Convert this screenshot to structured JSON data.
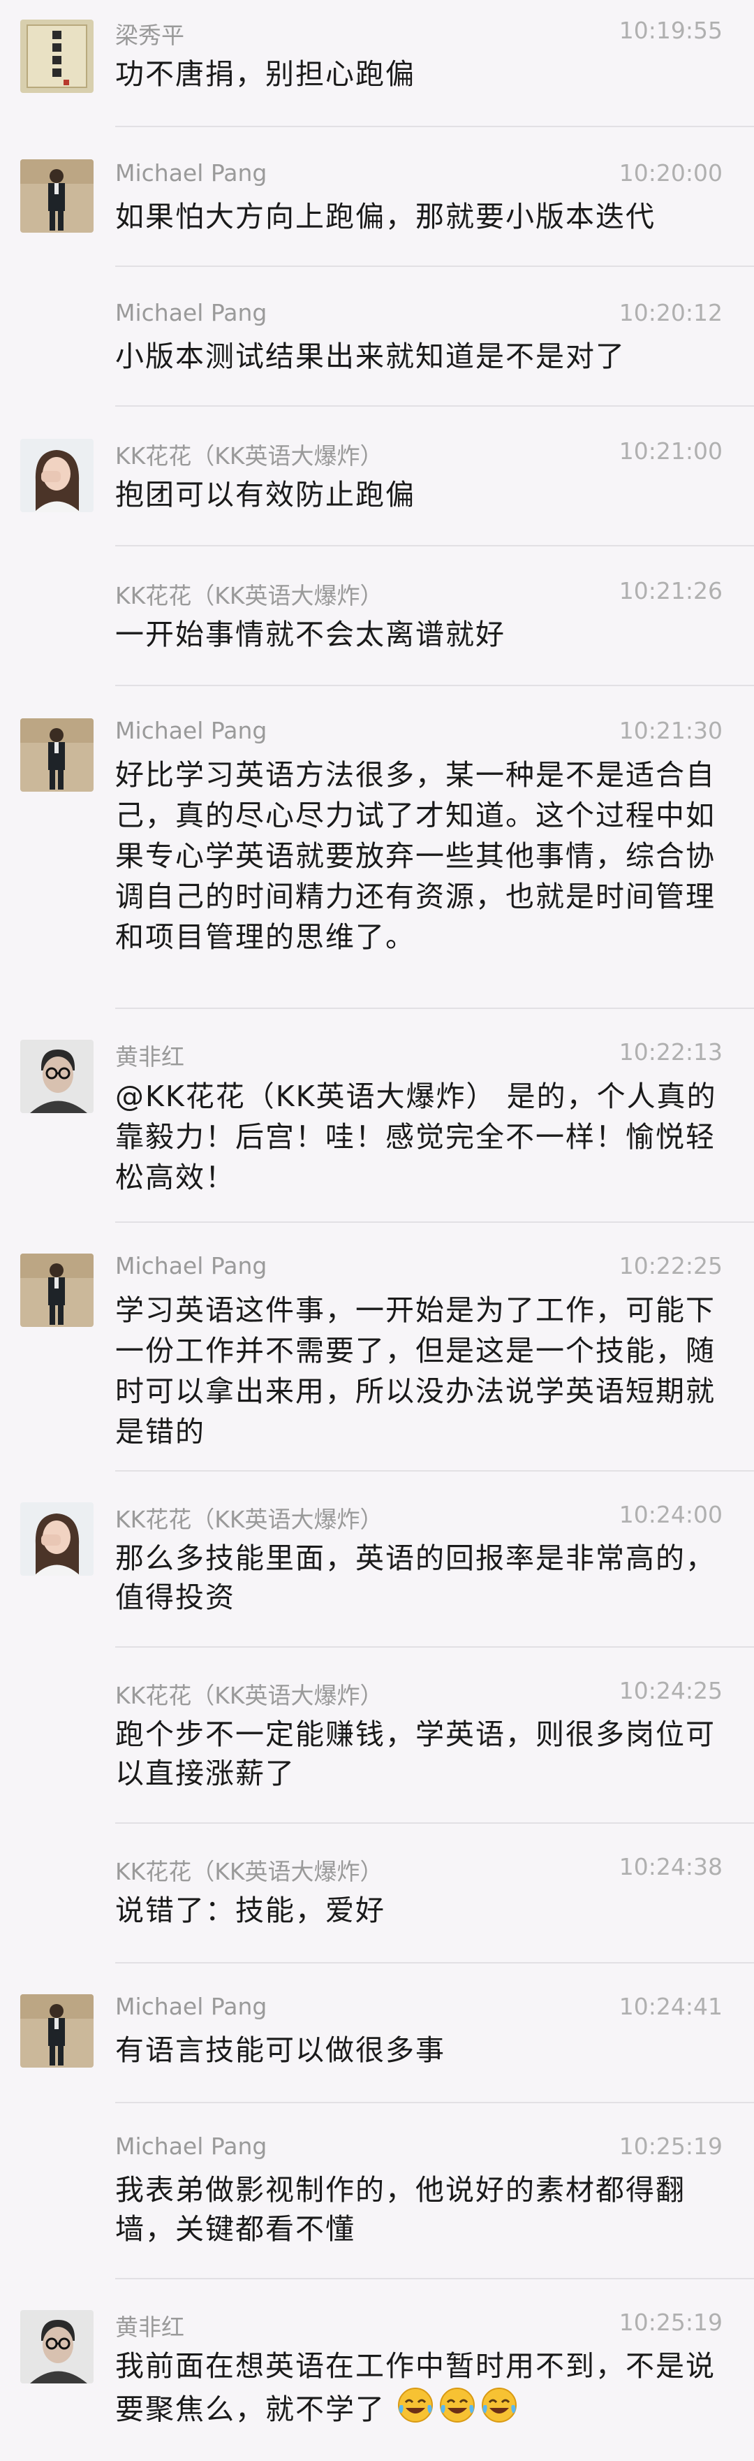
{
  "messages": [
    {
      "sender": "梁秀平",
      "avatar": "avatar-calligraphy",
      "time": "10:19:55",
      "text": "功不唐捐，别担心跑偏",
      "show_avatar": true
    },
    {
      "sender": "Michael Pang",
      "avatar": "avatar-man-suit",
      "time": "10:20:00",
      "text": "如果怕大方向上跑偏，那就要小版本迭代",
      "show_avatar": true
    },
    {
      "sender": "Michael Pang",
      "avatar": "",
      "time": "10:20:12",
      "text": "小版本测试结果出来就知道是不是对了",
      "show_avatar": false
    },
    {
      "sender": "KK花花（KK英语大爆炸）",
      "avatar": "avatar-woman",
      "time": "10:21:00",
      "text": "抱团可以有效防止跑偏",
      "show_avatar": true
    },
    {
      "sender": "KK花花（KK英语大爆炸）",
      "avatar": "",
      "time": "10:21:26",
      "text": "一开始事情就不会太离谱就好",
      "show_avatar": false
    },
    {
      "sender": "Michael Pang",
      "avatar": "avatar-man-suit",
      "time": "10:21:30",
      "text": "好比学习英语方法很多，某一种是不是适合自己，真的尽心尽力试了才知道。这个过程中如果专心学英语就要放弃一些其他事情，综合协调自己的时间精力还有资源，也就是时间管理和项目管理的思维了。",
      "show_avatar": true
    },
    {
      "sender": "黄非红",
      "avatar": "avatar-man-glasses",
      "time": "10:22:13",
      "text": "@KK花花（KK英语大爆炸） 是的，个人真的靠毅力！后宫！哇！感觉完全不一样！愉悦轻松高效！",
      "show_avatar": true
    },
    {
      "sender": "Michael Pang",
      "avatar": "avatar-man-suit",
      "time": "10:22:25",
      "text": "学习英语这件事，一开始是为了工作，可能下一份工作并不需要了，但是这是一个技能，随时可以拿出来用，所以没办法说学英语短期就是错的",
      "show_avatar": true
    },
    {
      "sender": "KK花花（KK英语大爆炸）",
      "avatar": "avatar-woman",
      "time": "10:24:00",
      "text": "那么多技能里面，英语的回报率是非常高的，值得投资",
      "show_avatar": true
    },
    {
      "sender": "KK花花（KK英语大爆炸）",
      "avatar": "",
      "time": "10:24:25",
      "text": "跑个步不一定能赚钱，学英语，则很多岗位可以直接涨薪了",
      "show_avatar": false
    },
    {
      "sender": "KK花花（KK英语大爆炸）",
      "avatar": "",
      "time": "10:24:38",
      "text": "说错了：技能，爱好",
      "show_avatar": false
    },
    {
      "sender": "Michael Pang",
      "avatar": "avatar-man-suit",
      "time": "10:24:41",
      "text": "有语言技能可以做很多事",
      "show_avatar": true
    },
    {
      "sender": "Michael Pang",
      "avatar": "",
      "time": "10:25:19",
      "text": "我表弟做影视制作的，他说好的素材都得翻墙，关键都看不懂",
      "show_avatar": false
    },
    {
      "sender": "黄非红",
      "avatar": "avatar-man-glasses",
      "time": "10:25:19",
      "text": "我前面在想英语在工作中暂时用不到，不是说要聚焦么，就不学了",
      "show_avatar": true,
      "trailing_emoji": [
        "tears-of-joy-emoji",
        "tears-of-joy-emoji",
        "tears-of-joy-emoji"
      ]
    }
  ]
}
